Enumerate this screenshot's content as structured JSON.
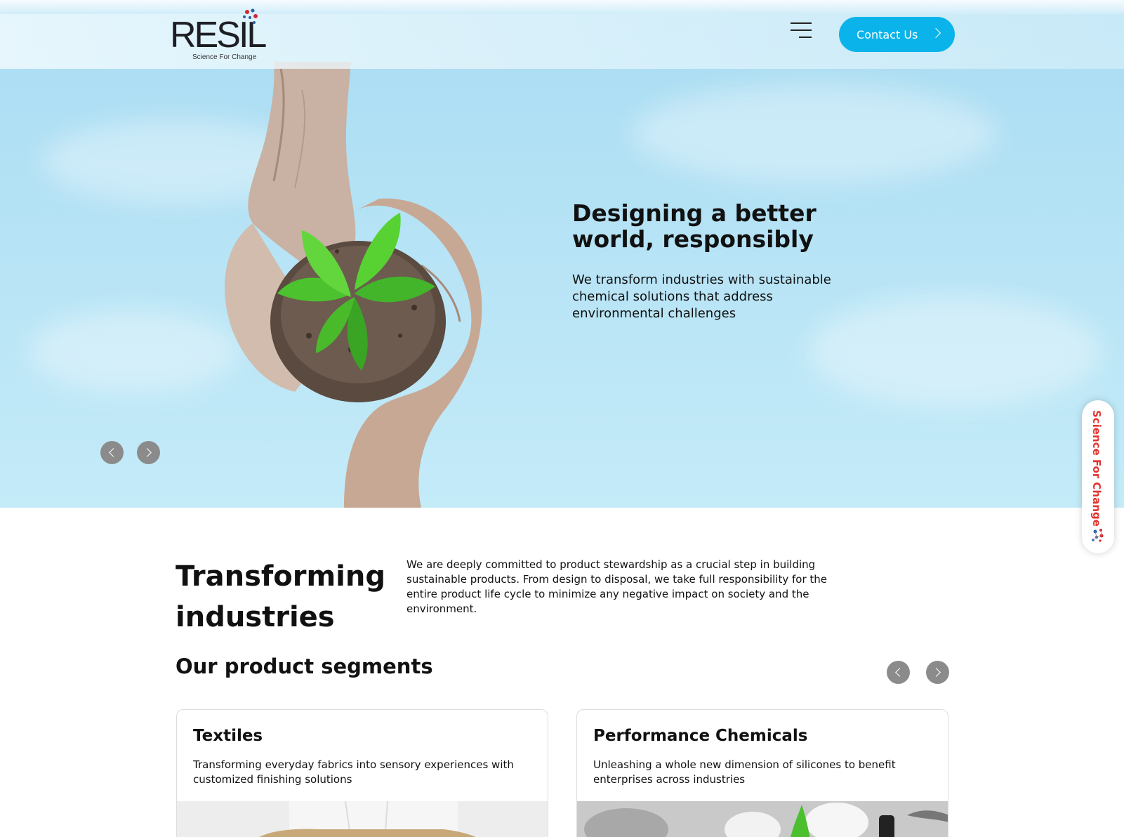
{
  "header": {
    "logo_text_left": "RE",
    "logo_text_mid": "S",
    "logo_text_right": "IL",
    "logo_tagline": "Science For Change",
    "contact_label": "Contact Us"
  },
  "hero": {
    "title": "Designing a better world, responsibly",
    "subtitle": "We transform industries with sustainable chemical solutions that address environmental challenges"
  },
  "side_tab": {
    "label": "Science For Change"
  },
  "intro": {
    "title_line1": "Transforming",
    "title_line2": "industries",
    "body": "We are deeply committed to product stewardship as a crucial step in building sustainable products. From design to disposal, we take full responsibility for the entire product life cycle to minimize any negative impact on society and the environment."
  },
  "segments": {
    "title": "Our product segments",
    "cards": [
      {
        "title": "Textiles",
        "description": "Transforming everyday fabrics into sensory experiences with customized finishing solutions"
      },
      {
        "title": "Performance Chemicals",
        "description": "Unleashing a whole new dimension of silicones to benefit enterprises across industries"
      }
    ]
  },
  "colors": {
    "accent": "#0ab4ea",
    "brand_red": "#d7262d",
    "sky_top": "#a9dcf2",
    "sky_bottom": "#c4ebf8"
  }
}
